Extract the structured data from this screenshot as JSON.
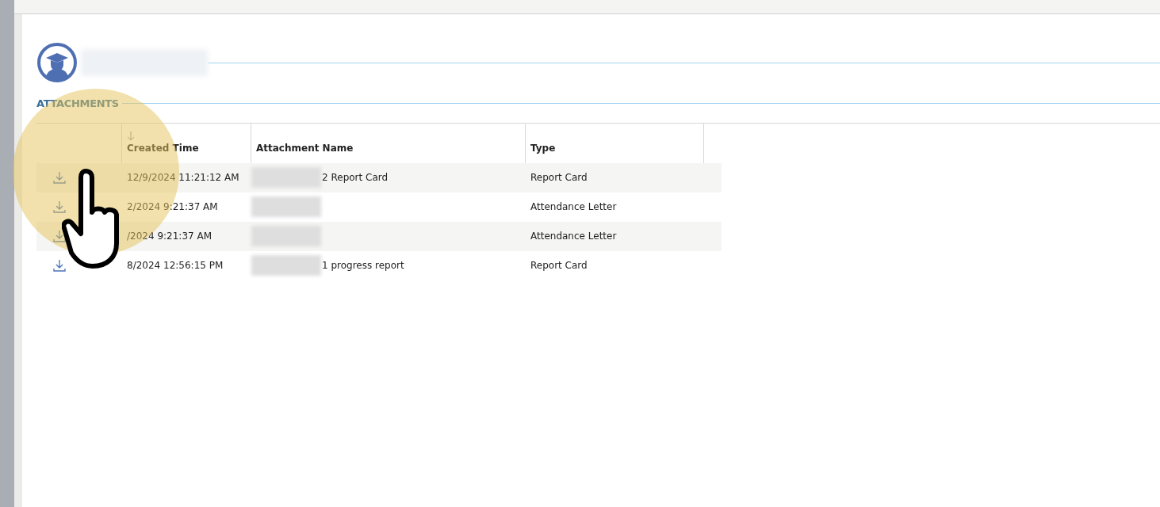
{
  "section": {
    "title": "ATTACHMENTS"
  },
  "table": {
    "columns": [
      {
        "label": "Created Time",
        "sorted": true
      },
      {
        "label": "Attachment Name",
        "sorted": false
      },
      {
        "label": "Type",
        "sorted": false
      }
    ],
    "rows": [
      {
        "created": "12/9/2024 11:21:12 AM",
        "name": "2 Report Card",
        "redacted": true,
        "type": "Report Card"
      },
      {
        "created": "2/2024 9:21:37 AM",
        "name": "",
        "redacted": true,
        "type": "Attendance Letter"
      },
      {
        "created": "/2024 9:21:37 AM",
        "name": "",
        "redacted": true,
        "type": "Attendance Letter"
      },
      {
        "created": "8/2024 12:56:15 PM",
        "name": "1 progress report",
        "redacted": true,
        "type": "Report Card"
      }
    ]
  }
}
